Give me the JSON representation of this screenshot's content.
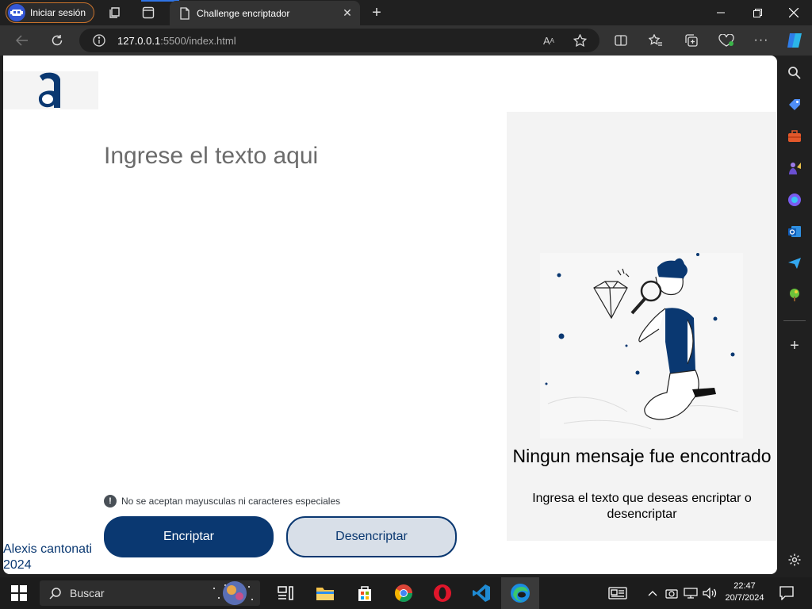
{
  "browser": {
    "profile_label": "Iniciar sesión",
    "tab_title": "Challenge encriptador",
    "url_host": "127.0.0.1",
    "url_rest": ":5500/index.html"
  },
  "page": {
    "input_placeholder": "Ingrese el texto aqui",
    "hint_text": "No se aceptan mayusculas ni caracteres especiales",
    "encrypt_label": "Encriptar",
    "decrypt_label": "Desencriptar",
    "footer_name": "Alexis cantonati",
    "footer_year": "2024",
    "result_title": "Ningun mensaje fue encontrado",
    "result_subtitle": "Ingresa el texto que deseas encriptar o desencriptar"
  },
  "taskbar": {
    "search_label": "Buscar",
    "time": "22:47",
    "date": "20/7/2024"
  },
  "colors": {
    "brand": "#0a3871",
    "edge_accent": "#2f74e6",
    "panel_bg": "#f3f3f3"
  }
}
